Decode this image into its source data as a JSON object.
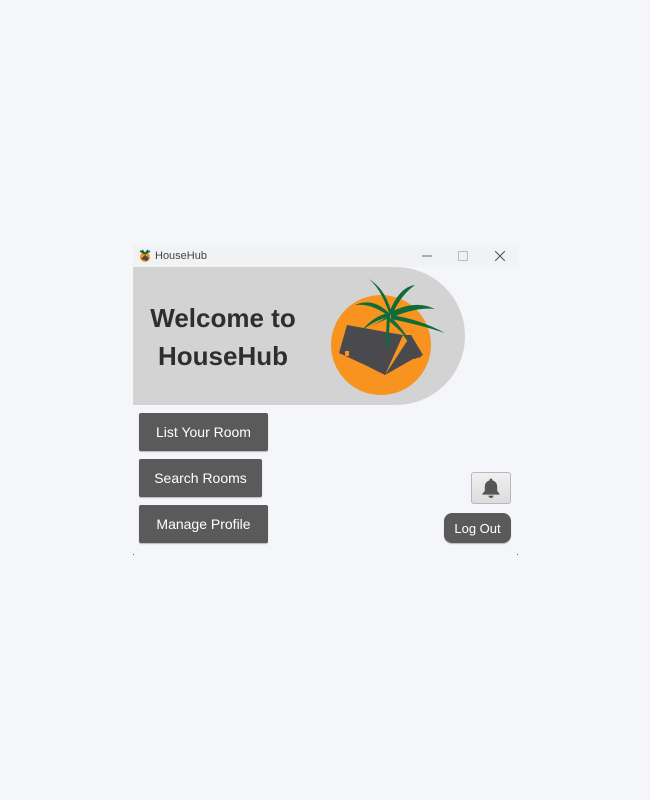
{
  "window": {
    "title": "HouseHub",
    "controls": [
      "minimize-icon",
      "maximize-icon",
      "close-icon"
    ]
  },
  "banner": {
    "welcome_line1": "Welcome to",
    "welcome_line2": "HouseHub",
    "logo": "palm-tree-house-logo"
  },
  "menu": {
    "list_room": "List Your Room",
    "search_rooms": "Search Rooms",
    "manage_profile": "Manage Profile"
  },
  "notifications": {
    "icon": "bell-icon"
  },
  "logout": {
    "label": "Log Out"
  },
  "colors": {
    "button_bg": "#5a5a5a",
    "banner_bg": "#d3d3d3",
    "logo_orange": "#f7931e",
    "logo_green": "#0f6b3a",
    "logo_house": "#4a4a4e"
  }
}
